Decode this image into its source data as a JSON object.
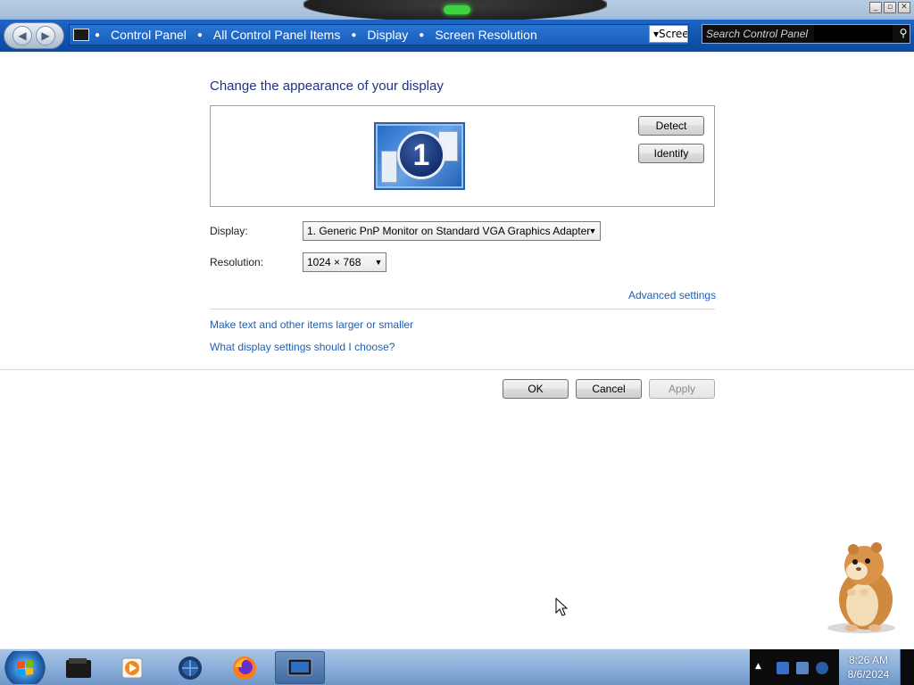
{
  "window": {
    "controls": {
      "minimize": "0",
      "maximize": "1",
      "close": "r"
    }
  },
  "address": {
    "breadcrumb": [
      "Control Panel",
      "All Control Panel Items",
      "Display",
      "Screen Resolution"
    ],
    "dropdown_text": "Scree",
    "search_placeholder": "Search Control Panel"
  },
  "content": {
    "heading": "Change the appearance of your display",
    "monitor_number": "1",
    "detect_label": "Detect",
    "identify_label": "Identify",
    "display_label": "Display:",
    "display_value": "1. Generic PnP Monitor on Standard VGA Graphics Adapter",
    "resolution_label": "Resolution:",
    "resolution_value": "1024 × 768",
    "advanced_link": "Advanced settings",
    "text_size_link": "Make text and other items larger or smaller",
    "help_link": "What display settings should I choose?",
    "ok_label": "OK",
    "cancel_label": "Cancel",
    "apply_label": "Apply"
  },
  "taskbar": {
    "apps": [
      {
        "icon": "files-icon"
      },
      {
        "icon": "media-player-icon"
      },
      {
        "icon": "network-globe-icon"
      },
      {
        "icon": "firefox-icon"
      },
      {
        "icon": "display-settings-icon"
      }
    ],
    "clock_time": "8:26 AM",
    "clock_date": "8/6/2024"
  },
  "colors": {
    "heading": "#1e3287",
    "link": "#1e5fb4",
    "navbar": "#1356b0"
  }
}
